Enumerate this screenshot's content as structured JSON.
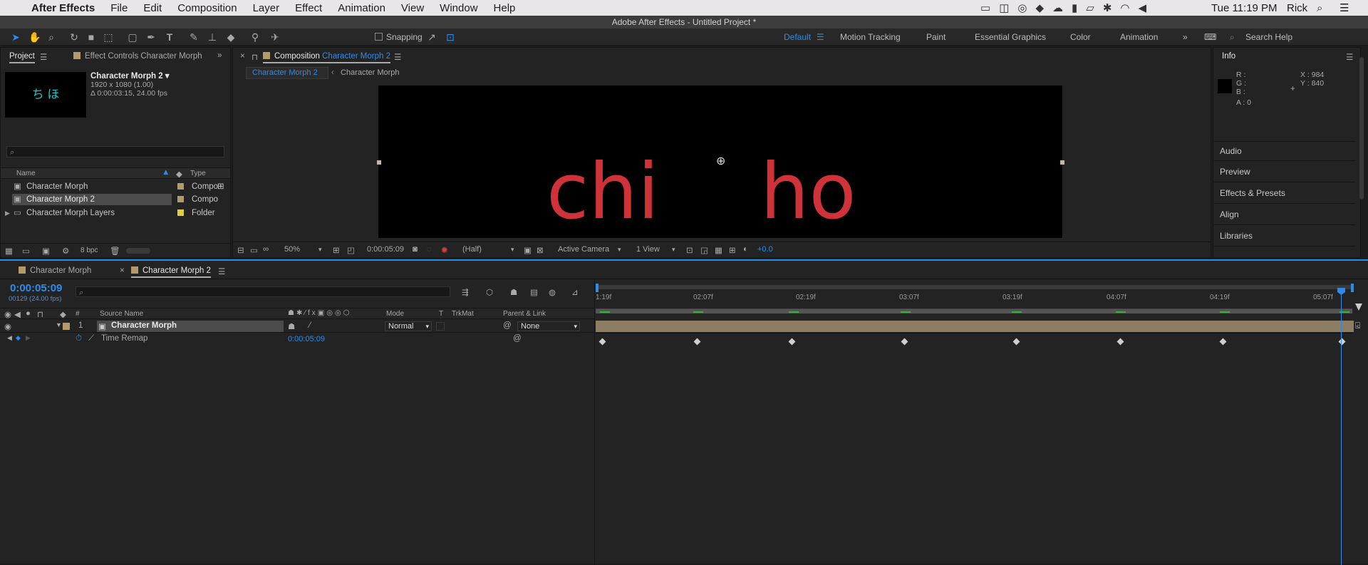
{
  "menubar": {
    "app": "After Effects",
    "items": [
      "File",
      "Edit",
      "Composition",
      "Layer",
      "Effect",
      "Animation",
      "View",
      "Window",
      "Help"
    ],
    "clock": "Tue 11:19 PM",
    "user": "Rick"
  },
  "title": "Adobe After Effects - Untitled Project *",
  "toolbar": {
    "snapping": "Snapping",
    "workspaces": [
      "Default",
      "Motion Tracking",
      "Paint",
      "Essential Graphics",
      "Color",
      "Animation"
    ],
    "search_placeholder": "Search Help"
  },
  "project": {
    "tab": "Project",
    "tab2": "Effect Controls Character Morph",
    "thumb_text": "ち ほ",
    "selected_name": "Character Morph 2 ▾",
    "info1": "1920 x 1080 (1.00)",
    "info2": "Δ 0:00:03:15, 24.00 fps",
    "col_name": "Name",
    "col_type": "Type",
    "items": [
      {
        "name": "Character Morph",
        "type": "Compo"
      },
      {
        "name": "Character Morph 2",
        "type": "Compo"
      },
      {
        "name": "Character Morph Layers",
        "type": "Folder"
      }
    ],
    "bpc": "8 bpc"
  },
  "comp": {
    "tab_prefix": "Composition",
    "tab_name": "Character Morph 2",
    "crumb1": "Character Morph 2",
    "crumb2": "Character Morph",
    "preview_text_left": "chi",
    "preview_text_right": "ho",
    "zoom": "50%",
    "time": "0:00:05:09",
    "resolution": "(Half)",
    "camera": "Active Camera",
    "views": "1 View",
    "exposure": "+0.0"
  },
  "info": {
    "title": "Info",
    "r": "R :",
    "g": "G :",
    "b": "B :",
    "a": "A : 0",
    "x": "X : 984",
    "y": "Y : 840",
    "sections": [
      "Audio",
      "Preview",
      "Effects & Presets",
      "Align",
      "Libraries"
    ]
  },
  "timeline": {
    "tab1": "Character Morph",
    "tab2": "Character Morph 2",
    "timecode": "0:00:05:09",
    "frames": "00129 (24.00 fps)",
    "cols": {
      "num": "#",
      "source": "Source Name",
      "mode": "Mode",
      "t": "T",
      "trkmat": "TrkMat",
      "parent": "Parent & Link"
    },
    "layer": {
      "num": "1",
      "name": "Character Morph",
      "mode": "Normal",
      "parent": "None"
    },
    "prop": {
      "name": "Time Remap",
      "value": "0:00:05:09"
    },
    "ruler": [
      "1:19f",
      "02:07f",
      "02:19f",
      "03:07f",
      "03:19f",
      "04:07f",
      "04:19f",
      "05:07f"
    ]
  },
  "colors": {
    "accent": "#2d8ceb",
    "preview_text": "#d0323a",
    "keyframe": "#cfcfcf",
    "layer_bar": "#8c7d63"
  }
}
